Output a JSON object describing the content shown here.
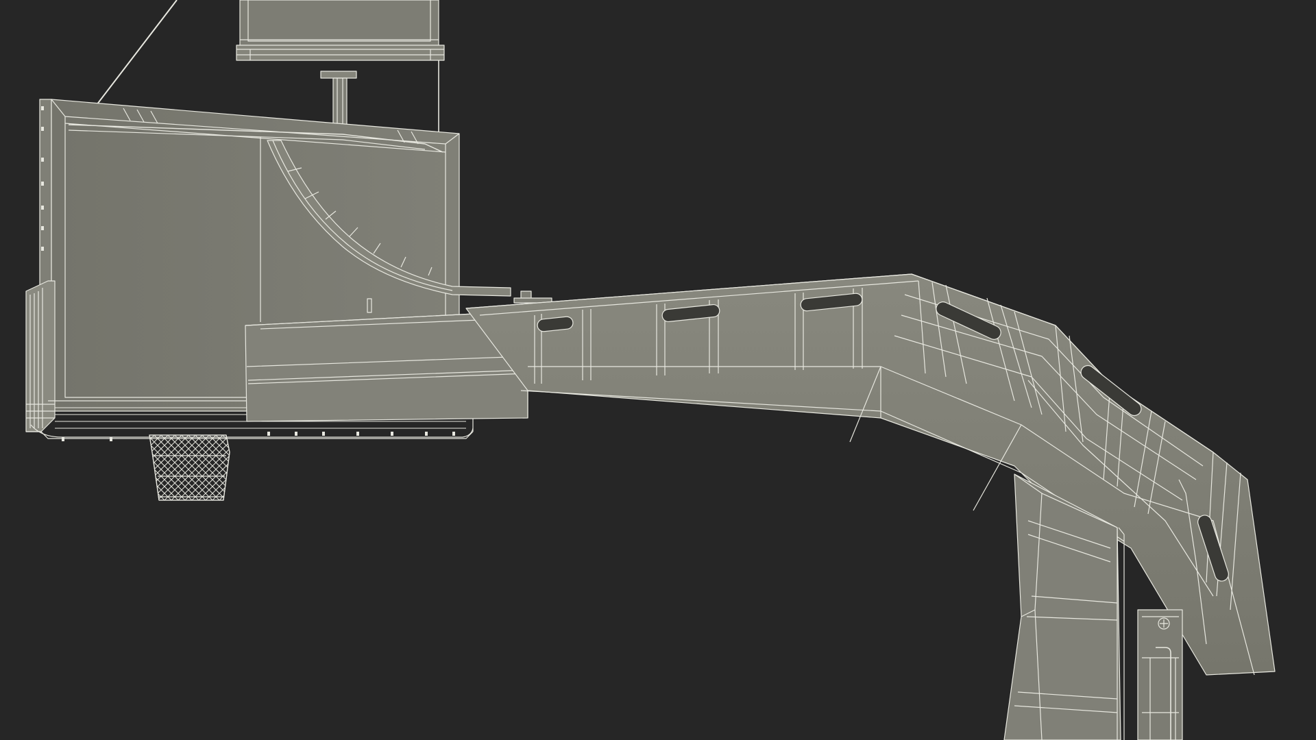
{
  "scene": {
    "subject": "",
    "background_color": "#262626",
    "model_fill": "#7b7b71",
    "model_fill_light": "#8a8a80",
    "model_fill_dark": "#6c6c63",
    "wire_color": "#e8e8e0",
    "shadow_color": "#4a4a44"
  }
}
